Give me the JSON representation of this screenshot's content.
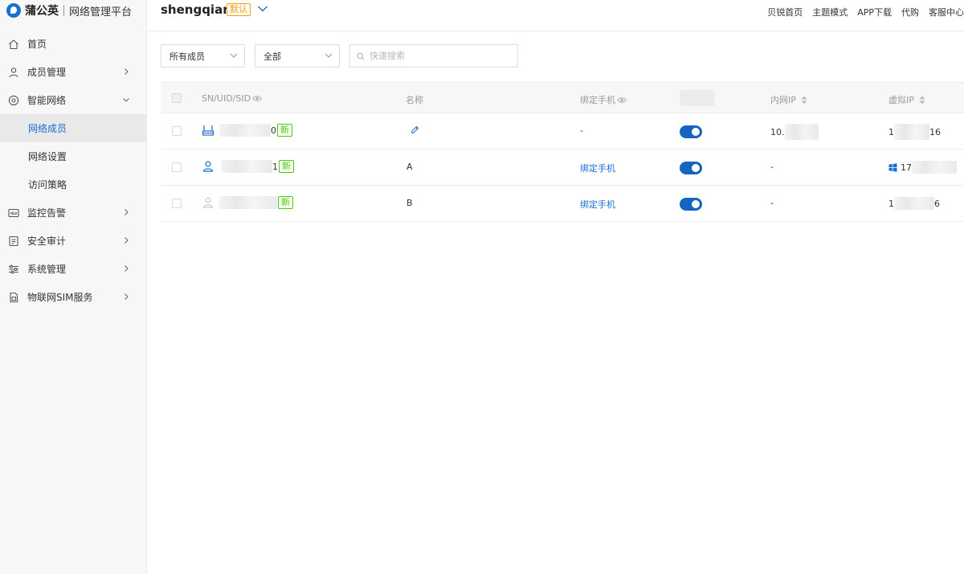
{
  "brand": {
    "name": "蒲公英",
    "subtitle": "网络管理平台"
  },
  "sidebar": {
    "items": [
      {
        "label": "首页",
        "icon": "home-icon"
      },
      {
        "label": "成员管理",
        "icon": "user-icon"
      },
      {
        "label": "智能网络",
        "icon": "network-icon"
      },
      {
        "label": "网络成员",
        "sub": true,
        "active": true
      },
      {
        "label": "网络设置",
        "sub": true
      },
      {
        "label": "访问策略",
        "sub": true
      },
      {
        "label": "监控告警",
        "icon": "monitor-icon"
      },
      {
        "label": "安全审计",
        "icon": "audit-icon"
      },
      {
        "label": "系统管理",
        "icon": "settings-icon"
      },
      {
        "label": "物联网SIM服务",
        "icon": "sim-icon"
      }
    ]
  },
  "header": {
    "network_name": "shengqian",
    "default_badge": "默认",
    "links": [
      "贝锐首页",
      "主题模式",
      "APP下载",
      "代购",
      "客服中心"
    ]
  },
  "filters": {
    "members": "所有成员",
    "status": "全部",
    "search_placeholder": "快速搜索"
  },
  "table": {
    "headers": {
      "sn": "SN/UID/SID",
      "name": "名称",
      "phone": "绑定手机",
      "lan_ip": "内网IP",
      "virtual_ip": "虚拟IP"
    },
    "rows": [
      {
        "sn_tail": "0",
        "new_badge": "新",
        "name": "",
        "phone": "-",
        "lan_ip_prefix": "10.",
        "virtual_ip_prefix": "1",
        "virtual_ip_suffix": "16",
        "enabled": true
      },
      {
        "sn_tail": "1",
        "new_badge": "新",
        "name": "A",
        "phone": "绑定手机",
        "lan_ip_prefix": "-",
        "virtual_ip_prefix": "17",
        "virtual_ip_suffix": "",
        "enabled": true
      },
      {
        "sn_tail": "",
        "new_badge": "新",
        "name": "B",
        "phone": "绑定手机",
        "lan_ip_prefix": "-",
        "virtual_ip_prefix": "1",
        "virtual_ip_suffix": "6",
        "enabled": true
      }
    ]
  },
  "colors": {
    "accent": "#1a6fd0",
    "toggle": "#1565c0",
    "new_badge": "#52c41a",
    "default_badge": "#f0a020"
  }
}
